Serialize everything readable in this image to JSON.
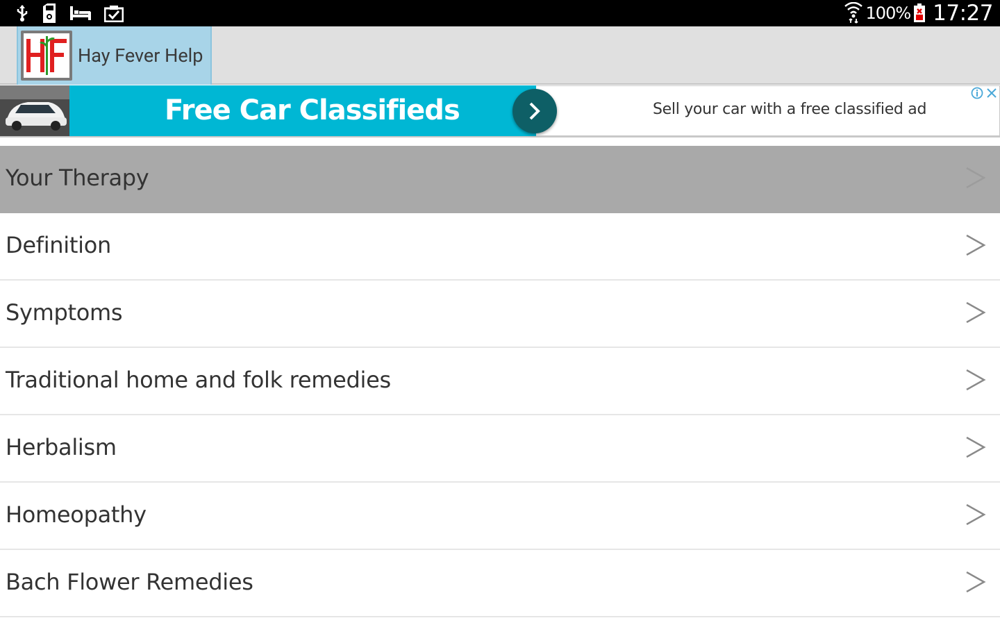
{
  "status_bar": {
    "icons_left": [
      "usb-icon",
      "sd-card-icon",
      "bed-icon",
      "clipboard-check-icon"
    ],
    "wifi_icon": "wifi-icon",
    "battery_percent": "100%",
    "battery_icon": "battery-alert-icon",
    "time": "17:27"
  },
  "action_bar": {
    "app_icon": "hay-fever-logo",
    "app_title": "Hay Fever Help"
  },
  "ad_banner": {
    "headline": "Free Car Classifieds",
    "description": "Sell your car with a free classified ad",
    "arrow_icon": "chevron-right-icon",
    "adchoices_icon": "adchoices-icon",
    "close_icon": "close-icon",
    "accent_color": "#00b7d4"
  },
  "menu": {
    "items": [
      {
        "label": "Your Therapy",
        "selected": true
      },
      {
        "label": "Definition"
      },
      {
        "label": "Symptoms"
      },
      {
        "label": "Traditional home and folk remedies"
      },
      {
        "label": "Herbalism"
      },
      {
        "label": "Homeopathy"
      },
      {
        "label": "Bach Flower Remedies"
      }
    ]
  }
}
